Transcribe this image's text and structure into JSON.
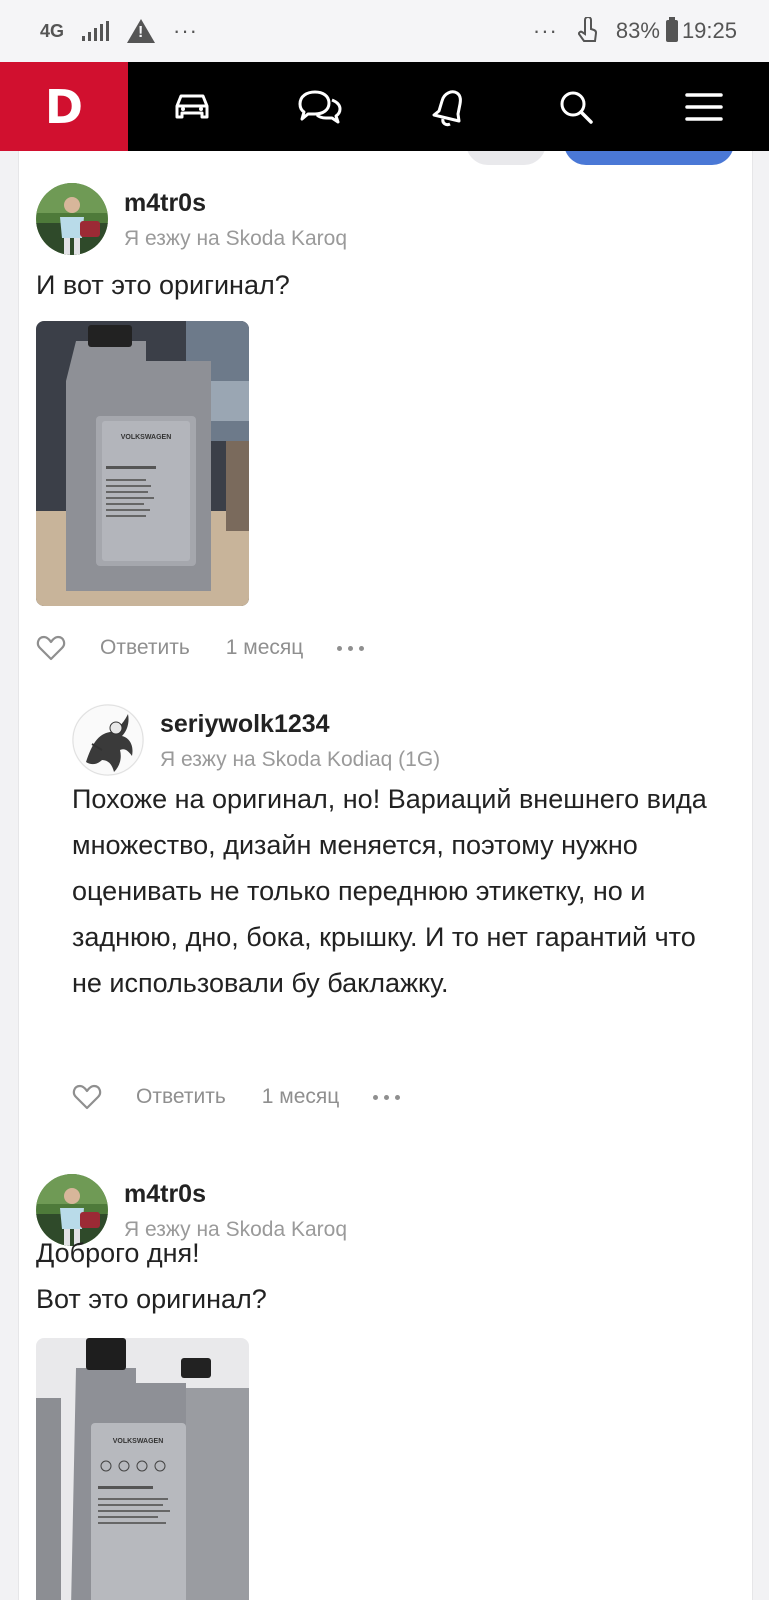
{
  "status_bar": {
    "network": "4G",
    "left_dots": "···",
    "right_dots": "···",
    "battery": "83%",
    "time": "19:25"
  },
  "nav": {
    "logo": "D",
    "icons": [
      "car-icon",
      "chat-icon",
      "bell-icon",
      "search-icon",
      "menu-icon"
    ]
  },
  "comments": [
    {
      "author": "m4tr0s",
      "car": "Я езжу на Skoda Karoq",
      "text": "И вот это оригинал?",
      "reply_label": "Ответить",
      "date": "1 месяц"
    },
    {
      "author": "seriywolk1234",
      "car": "Я езжу на Skoda Kodiaq (1G)",
      "text": "Похоже на оригинал, но! Вариаций внешнего вида множество, дизайн меняется, поэтому нужно оценивать не только переднюю этикетку, но и заднюю, дно, бока, крышку. И то нет гарантий что не использовали бу баклажку.",
      "reply_label": "Ответить",
      "date": "1 месяц"
    },
    {
      "author": "m4tr0s",
      "car": "Я езжу на Skoda Karoq",
      "text_lines": [
        "Доброго дня!",
        "Вот это оригинал?"
      ]
    }
  ],
  "colors": {
    "brand_red": "#d1102f",
    "nav_bg": "#000000",
    "accent_blue": "#4a78d6"
  }
}
